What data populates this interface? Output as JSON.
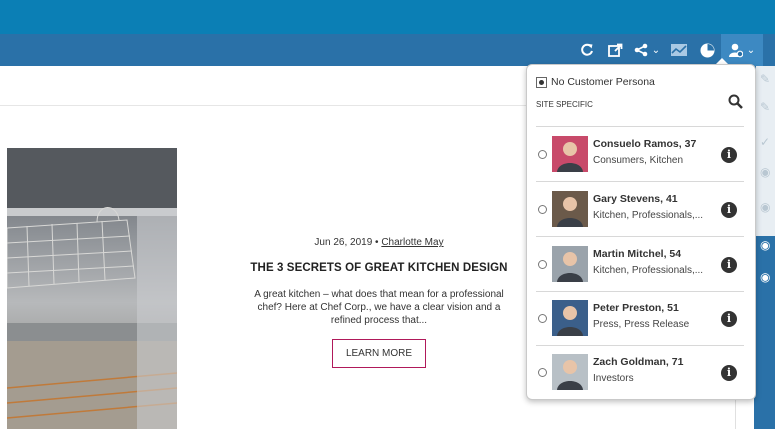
{
  "toolbar": {
    "icons": [
      "refresh-icon",
      "external-link-icon",
      "share-icon",
      "chevron-down-icon",
      "analytics-icon",
      "clock-icon",
      "persona-icon",
      "chevron-down-icon"
    ]
  },
  "article": {
    "date": "Jun 26, 2019",
    "separator": "•",
    "author": "Charlotte May",
    "title": "THE 3 SECRETS OF GREAT KITCHEN DESIGN",
    "excerpt": "A great kitchen – what does that mean for a professional chef? Here at Chef Corp., we have a clear vision and a refined process that...",
    "cta": "LEARN MORE"
  },
  "persona_panel": {
    "no_persona_label": "No Customer Persona",
    "section_label": "SITE SPECIFIC",
    "personas": [
      {
        "name": "Consuelo Ramos, 37",
        "tags": "Consumers, Kitchen",
        "avatar_color": "#c84a6a"
      },
      {
        "name": "Gary Stevens, 41",
        "tags": "Kitchen, Professionals,...",
        "avatar_color": "#6b5a4a"
      },
      {
        "name": "Martin Mitchel, 54",
        "tags": "Kitchen, Professionals,...",
        "avatar_color": "#9aa3ab"
      },
      {
        "name": "Peter Preston, 51",
        "tags": "Press, Press Release",
        "avatar_color": "#3b5f8a"
      },
      {
        "name": "Zach Goldman, 71",
        "tags": "Investors",
        "avatar_color": "#b8c0c6"
      }
    ]
  },
  "colors": {
    "topbar": "#0b7fb5",
    "toolbar": "#2a71a8",
    "cta_border": "#b0195a"
  }
}
